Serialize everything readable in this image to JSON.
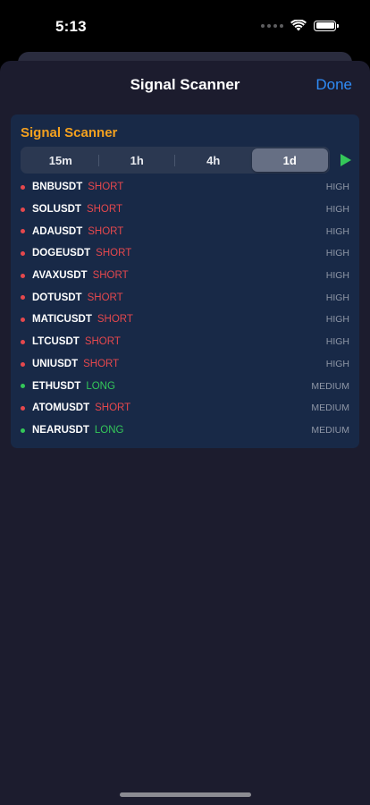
{
  "status_bar": {
    "time": "5:13"
  },
  "nav": {
    "title": "Signal Scanner",
    "done_label": "Done"
  },
  "card": {
    "title": "Signal Scanner"
  },
  "timeframes": {
    "options": [
      "15m",
      "1h",
      "4h",
      "1d"
    ],
    "selected": "1d"
  },
  "colors": {
    "short": "#e5484d",
    "long": "#34c759",
    "accent_orange": "#f4a11f",
    "done_blue": "#2f8cf7"
  },
  "signals": [
    {
      "symbol": "BNBUSDT",
      "direction": "SHORT",
      "confidence": "HIGH"
    },
    {
      "symbol": "SOLUSDT",
      "direction": "SHORT",
      "confidence": "HIGH"
    },
    {
      "symbol": "ADAUSDT",
      "direction": "SHORT",
      "confidence": "HIGH"
    },
    {
      "symbol": "DOGEUSDT",
      "direction": "SHORT",
      "confidence": "HIGH"
    },
    {
      "symbol": "AVAXUSDT",
      "direction": "SHORT",
      "confidence": "HIGH"
    },
    {
      "symbol": "DOTUSDT",
      "direction": "SHORT",
      "confidence": "HIGH"
    },
    {
      "symbol": "MATICUSDT",
      "direction": "SHORT",
      "confidence": "HIGH"
    },
    {
      "symbol": "LTCUSDT",
      "direction": "SHORT",
      "confidence": "HIGH"
    },
    {
      "symbol": "UNIUSDT",
      "direction": "SHORT",
      "confidence": "HIGH"
    },
    {
      "symbol": "ETHUSDT",
      "direction": "LONG",
      "confidence": "MEDIUM"
    },
    {
      "symbol": "ATOMUSDT",
      "direction": "SHORT",
      "confidence": "MEDIUM"
    },
    {
      "symbol": "NEARUSDT",
      "direction": "LONG",
      "confidence": "MEDIUM"
    }
  ]
}
